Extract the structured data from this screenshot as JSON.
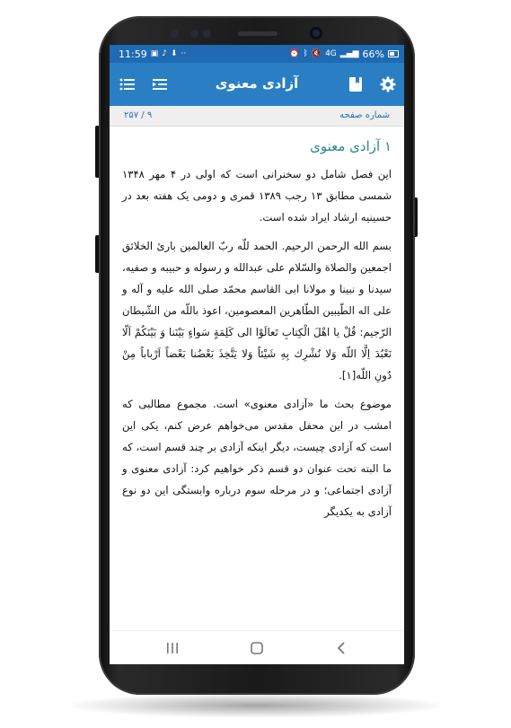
{
  "status_bar": {
    "time": "11:59",
    "battery": "66%",
    "network": "4G"
  },
  "app_bar": {
    "title": "آزادی معنوی",
    "icons": [
      "list-icon",
      "list-indent-icon",
      "bookmark-book-icon",
      "gear-icon"
    ]
  },
  "page_info": {
    "label": "شماره صفحه",
    "page": "۹ / ۲۵۷"
  },
  "content": {
    "heading": "۱ آزادی معنوی",
    "paragraphs": [
      "این فصل شامل دو سخنرانی است که اولی در ۴ مهر ۱۳۴۸ شمسی مطابق ۱۳ رجب ۱۳۸۹ قمری و دومی یک هفته بعد در حسینیه ارشاد ایراد شده است.",
      "بسم الله الرحمن الرحیم. الحمد للّه ربّ العالمین باریٔ الخلائق اجمعین والصلاة والسّلام علی عبدالله و رسوله و حبیبه و صفیه، سیدنا و نبینا و مولانا ابی القاسم محمّد صلی الله علیه و آله و علی اله الطّیبین الطّاهرین المعصومین، اعوذ باللّه من الشّیطان الرّجیم: قُلْ یا اهْلَ الْكِتابِ تَعالَوْا الی كَلِمَةٍ سَواءٍ بَیْنَنا وَ بَیْنَكُمْ اَلّا نَعْبُدَ اِلَّا اللّه وَلا نُشْرِك بِهِ شَیْئاً وَلا یَتَّخِذَ بَعْضُنا بَعْضاً اَرْباباً مِنْ دُونِ اللّه[۱].",
      "موضوع بحث ما «آزادی معنوی» است. مجموع مطالبی که امشب در این محفل مقدس می‌خواهم عرض کنم، یکی این است که آزادی چیست، دیگر اینکه آزادی بر چند قسم است، که ما البته تحت عنوان دو قسم ذکر خواهیم کرد: آزادی معنوی و آزادی اجتماعی؛ و در مرحله سوم درباره وابستگی این دو نوع آزادی به یکدیگر"
    ]
  },
  "nav_bar": {
    "icons": [
      "recent-apps-icon",
      "home-icon",
      "back-icon"
    ]
  },
  "colors": {
    "status_bar": "#1f6ab2",
    "app_bar": "#2a7fc4",
    "heading": "#2a8a8a",
    "page_info_text": "#2a6fad"
  }
}
